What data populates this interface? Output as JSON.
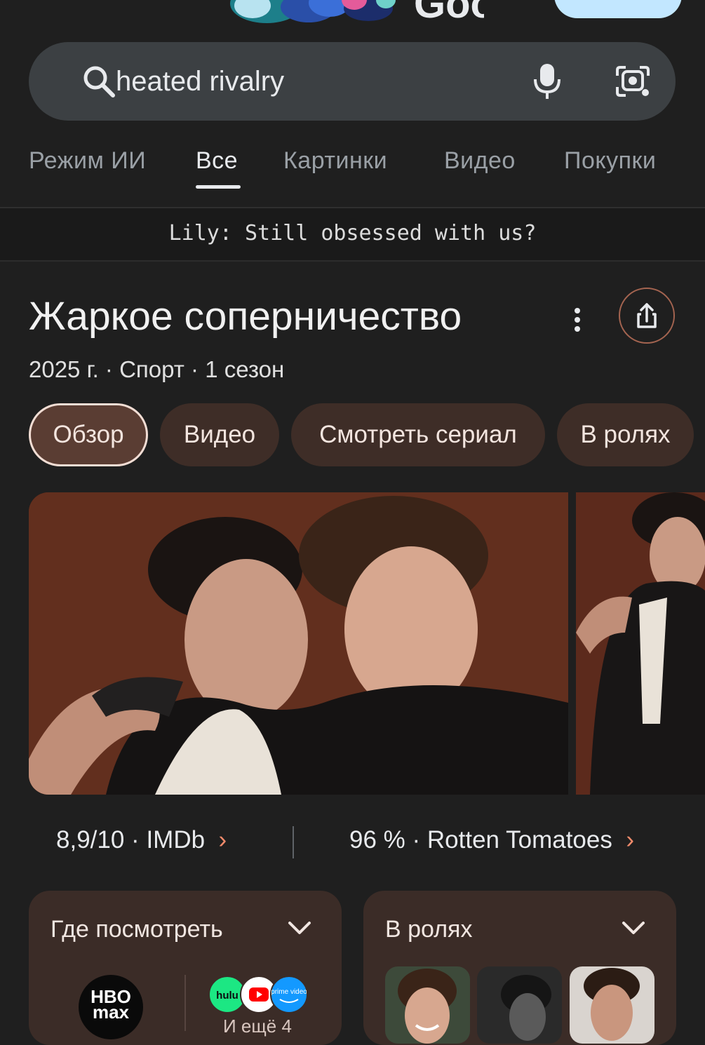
{
  "header": {
    "logo_text": "Google"
  },
  "search": {
    "query": "heated rivalry",
    "icons": [
      "search-icon",
      "microphone-icon",
      "camera-lens-icon"
    ]
  },
  "tabs": [
    {
      "label": "Режим ИИ",
      "active": false
    },
    {
      "label": "Все",
      "active": true
    },
    {
      "label": "Картинки",
      "active": false
    },
    {
      "label": "Видео",
      "active": false
    },
    {
      "label": "Покупки",
      "active": false
    }
  ],
  "overlay": {
    "text": "Lily: Still obsessed with us?"
  },
  "entity": {
    "title": "Жаркое соперничество",
    "subtitle": "2025 г. · Спорт · 1 сезон",
    "icons": [
      "more-vert-icon",
      "share-icon"
    ]
  },
  "chips": [
    {
      "label": "Обзор",
      "active": true
    },
    {
      "label": "Видео",
      "active": false
    },
    {
      "label": "Смотреть сериал",
      "active": false
    },
    {
      "label": "В ролях",
      "active": false
    }
  ],
  "ratings": [
    {
      "score": "8,9/10",
      "source": "IMDb"
    },
    {
      "score": "96 %",
      "source": "Rotten Tomatoes"
    }
  ],
  "cards": {
    "watch": {
      "title": "Где посмотреть",
      "providers": [
        "HBO max",
        "hulu",
        "YouTube",
        "prime video"
      ],
      "hbo_line1": "HBO",
      "hbo_line2": "max",
      "hulu_label": "hulu",
      "prime_label": "prime video",
      "more_text": "И ещё 4"
    },
    "cast": {
      "title": "В ролях"
    }
  },
  "colors": {
    "background": "#1f1f1f",
    "search_bg": "#3c4043",
    "chip_bg": "#3e2d27",
    "chip_active_border": "#f2ddd4",
    "accent": "#f28b6b",
    "card_bg": "#3b2c27"
  }
}
